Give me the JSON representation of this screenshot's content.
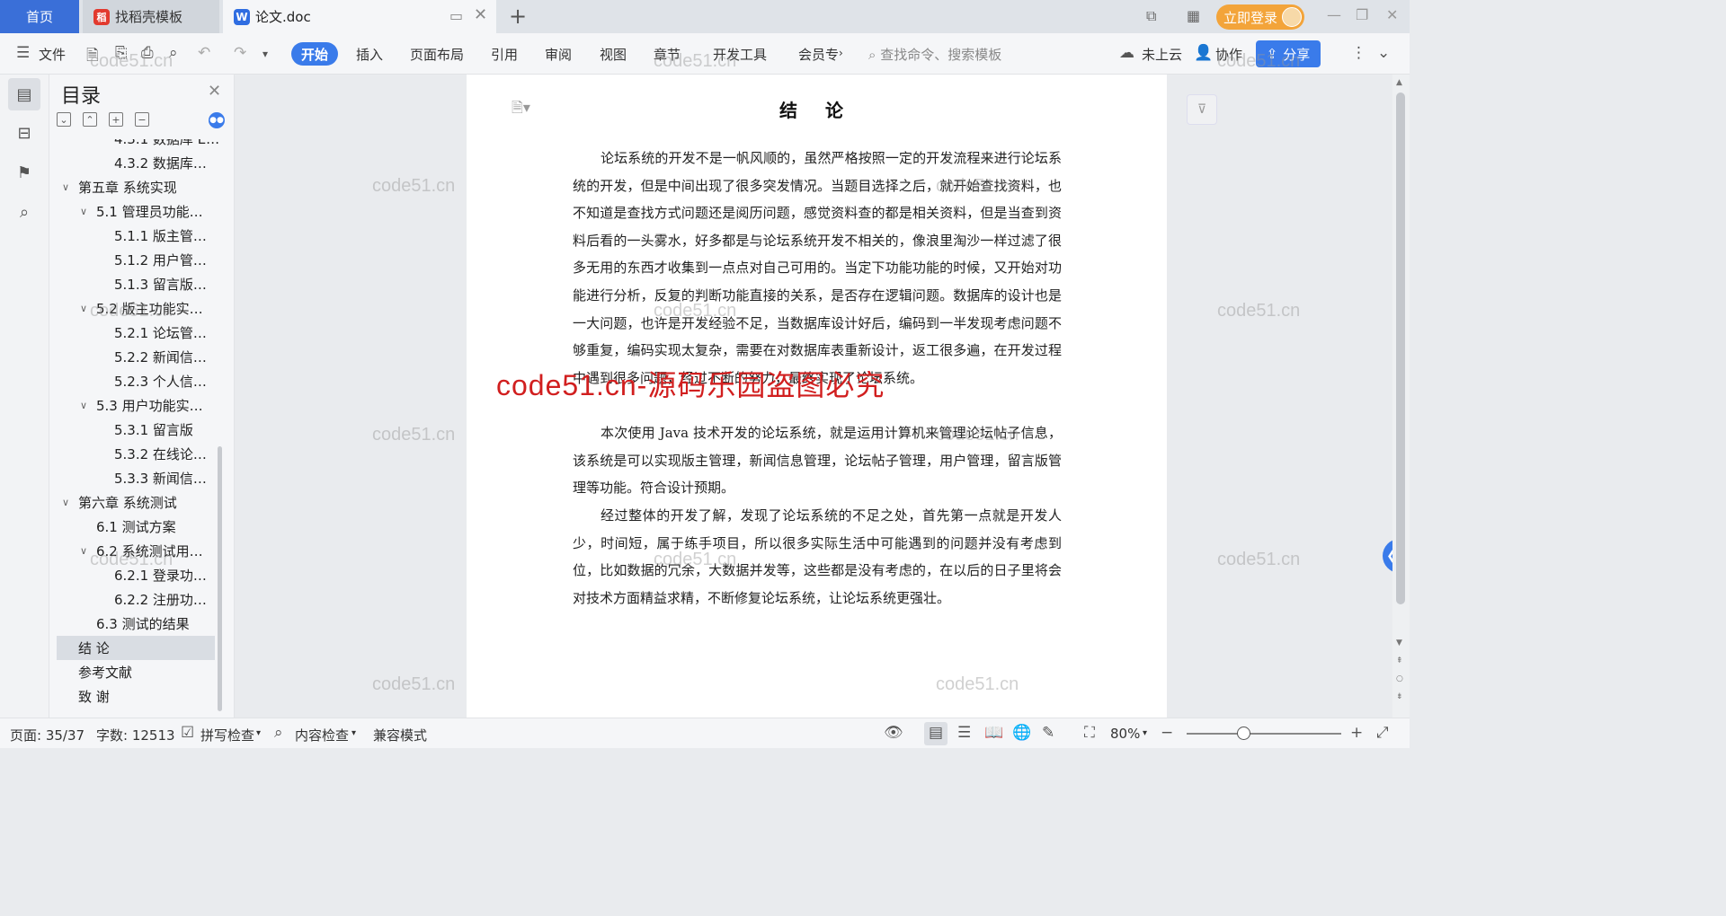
{
  "tabs": {
    "home": "首页",
    "find_template": "找稻壳模板",
    "doc_title": "论文.doc",
    "login": "立即登录"
  },
  "toolbar": {
    "file": "文件",
    "menus": [
      "开始",
      "插入",
      "页面布局",
      "引用",
      "审阅",
      "视图",
      "章节",
      "开发工具",
      "会员专"
    ],
    "search_placeholder": "查找命令、搜索模板",
    "cloud": "未上云",
    "collab": "协作",
    "share": "分享"
  },
  "toc": {
    "title": "目录",
    "items": [
      {
        "label": "4.3.1 数据库 E…",
        "level": 3
      },
      {
        "label": "4.3.2 数据库…",
        "level": 3
      },
      {
        "label": "第五章 系统实现",
        "level": 1,
        "expanded": true
      },
      {
        "label": "5.1 管理员功能…",
        "level": 2,
        "expanded": true
      },
      {
        "label": "5.1.1 版主管…",
        "level": 3
      },
      {
        "label": "5.1.2 用户管…",
        "level": 3
      },
      {
        "label": "5.1.3 留言版…",
        "level": 3
      },
      {
        "label": "5.2 版主功能实…",
        "level": 2,
        "expanded": true
      },
      {
        "label": "5.2.1 论坛管…",
        "level": 3
      },
      {
        "label": "5.2.2 新闻信…",
        "level": 3
      },
      {
        "label": "5.2.3 个人信…",
        "level": 3
      },
      {
        "label": "5.3 用户功能实…",
        "level": 2,
        "expanded": true
      },
      {
        "label": "5.3.1 留言版",
        "level": 3
      },
      {
        "label": "5.3.2 在线论…",
        "level": 3
      },
      {
        "label": "5.3.3 新闻信…",
        "level": 3
      },
      {
        "label": "第六章 系统测试",
        "level": 1,
        "expanded": true
      },
      {
        "label": "6.1 测试方案",
        "level": 2
      },
      {
        "label": "6.2 系统测试用…",
        "level": 2,
        "expanded": true
      },
      {
        "label": "6.2.1 登录功…",
        "level": 3
      },
      {
        "label": "6.2.2 注册功…",
        "level": 3
      },
      {
        "label": "6.3 测试的结果",
        "level": 2
      },
      {
        "label": "结  论",
        "level": 1,
        "active": true
      },
      {
        "label": "参考文献",
        "level": 1
      },
      {
        "label": "致  谢",
        "level": 1
      }
    ]
  },
  "document": {
    "heading": "结 论",
    "paragraphs": [
      "论坛系统的开发不是一帆风顺的，虽然严格按照一定的开发流程来进行论坛系统的开发，但是中间出现了很多突发情况。当题目选择之后，就开始查找资料，也不知道是查找方式问题还是阅历问题，感觉资料查的都是相关资料，但是当查到资料后看的一头雾水，好多都是与论坛系统开发不相关的，像浪里淘沙一样过滤了很多无用的东西才收集到一点点对自己可用的。当定下功能功能的时候，又开始对功能进行分析，反复的判断功能直接的关系，是否存在逻辑问题。数据库的设计也是一大问题，也许是开发经验不足，当数据库设计好后，编码到一半发现考虑问题不够重复，编码实现太复杂，需要在对数据库表重新设计，返工很多遍，在开发过程中遇到很多问题，经过不断的努力，最终实现了论坛系统。",
      "本次使用 Java 技术开发的论坛系统，就是运用计算机来管理论坛帖子信息，该系统是可以实现版主管理，新闻信息管理，论坛帖子管理，用户管理，留言版管理等功能。符合设计预期。",
      "经过整体的开发了解，发现了论坛系统的不足之处，首先第一点就是开发人少，时间短，属于练手项目，所以很多实际生活中可能遇到的问题并没有考虑到位，比如数据的冗余，大数据并发等，这些都是没有考虑的，在以后的日子里将会对技术方面精益求精，不断修复论坛系统，让论坛系统更强壮。"
    ]
  },
  "watermark": {
    "light": "code51.cn",
    "red": "code51.cn-源码乐园盗图必究"
  },
  "status": {
    "page": "页面: 35/37",
    "words": "字数: 12513",
    "spell_check": "拼写检查",
    "content_check": "内容检查",
    "compat_mode": "兼容模式",
    "zoom": "80%"
  },
  "colors": {
    "accent": "#3a7bea",
    "login": "#f3a43a",
    "watermark_red": "#d11f1f"
  }
}
